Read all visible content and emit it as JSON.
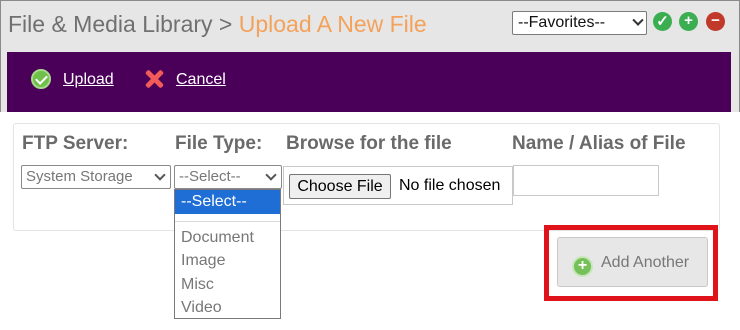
{
  "header": {
    "section": "File & Media Library",
    "separator": ">",
    "current": "Upload A New File",
    "favorites_value": "--Favorites--",
    "icons": [
      "check-icon",
      "plus-icon",
      "minus-icon"
    ]
  },
  "toolbar": {
    "upload_label": "Upload",
    "cancel_label": "Cancel"
  },
  "form": {
    "columns": {
      "ftp": "FTP Server:",
      "type": "File Type:",
      "browse": "Browse for the file",
      "alias": "Name / Alias of File"
    },
    "ftp_value": "System Storage",
    "type_value": "--Select--",
    "choose_file_label": "Choose File",
    "no_file_text": "No file chosen",
    "alias_value": ""
  },
  "dropdown": {
    "selected": "--Select--",
    "options": [
      "Document",
      "Image",
      "Misc",
      "Video"
    ]
  },
  "actions": {
    "add_another_label": "Add Another"
  },
  "colors": {
    "toolbar_bg": "#4a0059",
    "accent_orange": "#f4a25b",
    "highlight_red": "#e0131b",
    "select_blue": "#1e6ed6"
  }
}
